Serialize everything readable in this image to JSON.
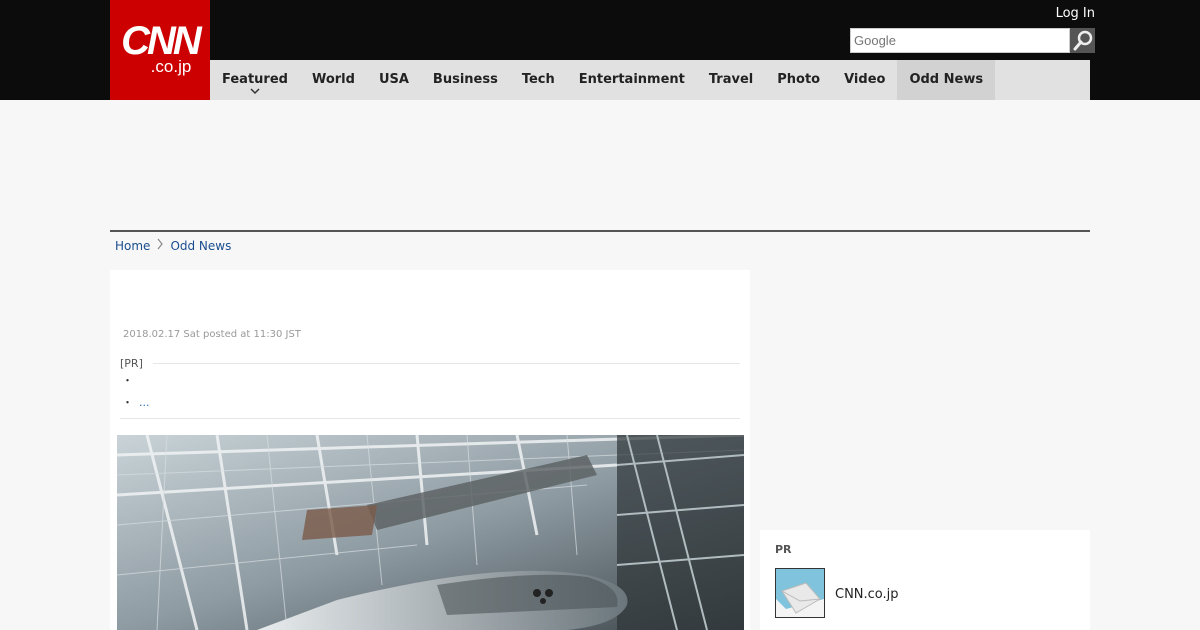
{
  "header": {
    "logo_main": "CNN",
    "logo_sub": ".co.jp",
    "login_label": "Log In",
    "search_placeholder": "Google"
  },
  "nav": {
    "items": [
      "Featured",
      "World",
      "USA",
      "Business",
      "Tech",
      "Entertainment",
      "Travel",
      "Photo",
      "Video",
      "Odd News"
    ],
    "active": "Odd News"
  },
  "breadcrumb": {
    "home": "Home",
    "current": "Odd News"
  },
  "article": {
    "date": "2018.02.17 Sat posted at 11:30 JST",
    "pr_label": "[PR]",
    "pr_bullet_1": "・",
    "pr_bullet_2": "・",
    "pr_link": "..."
  },
  "sidebar": {
    "pr_label": "PR",
    "pr_item_text": "CNN.co.jp"
  },
  "colors": {
    "brand_red": "#cc0000",
    "topbar": "#0c0c0c",
    "nav_bg": "#e1e1e1",
    "link": "#1a4d8f"
  },
  "icons": [
    "search-icon",
    "chevron-down-icon",
    "chevron-right-icon"
  ]
}
